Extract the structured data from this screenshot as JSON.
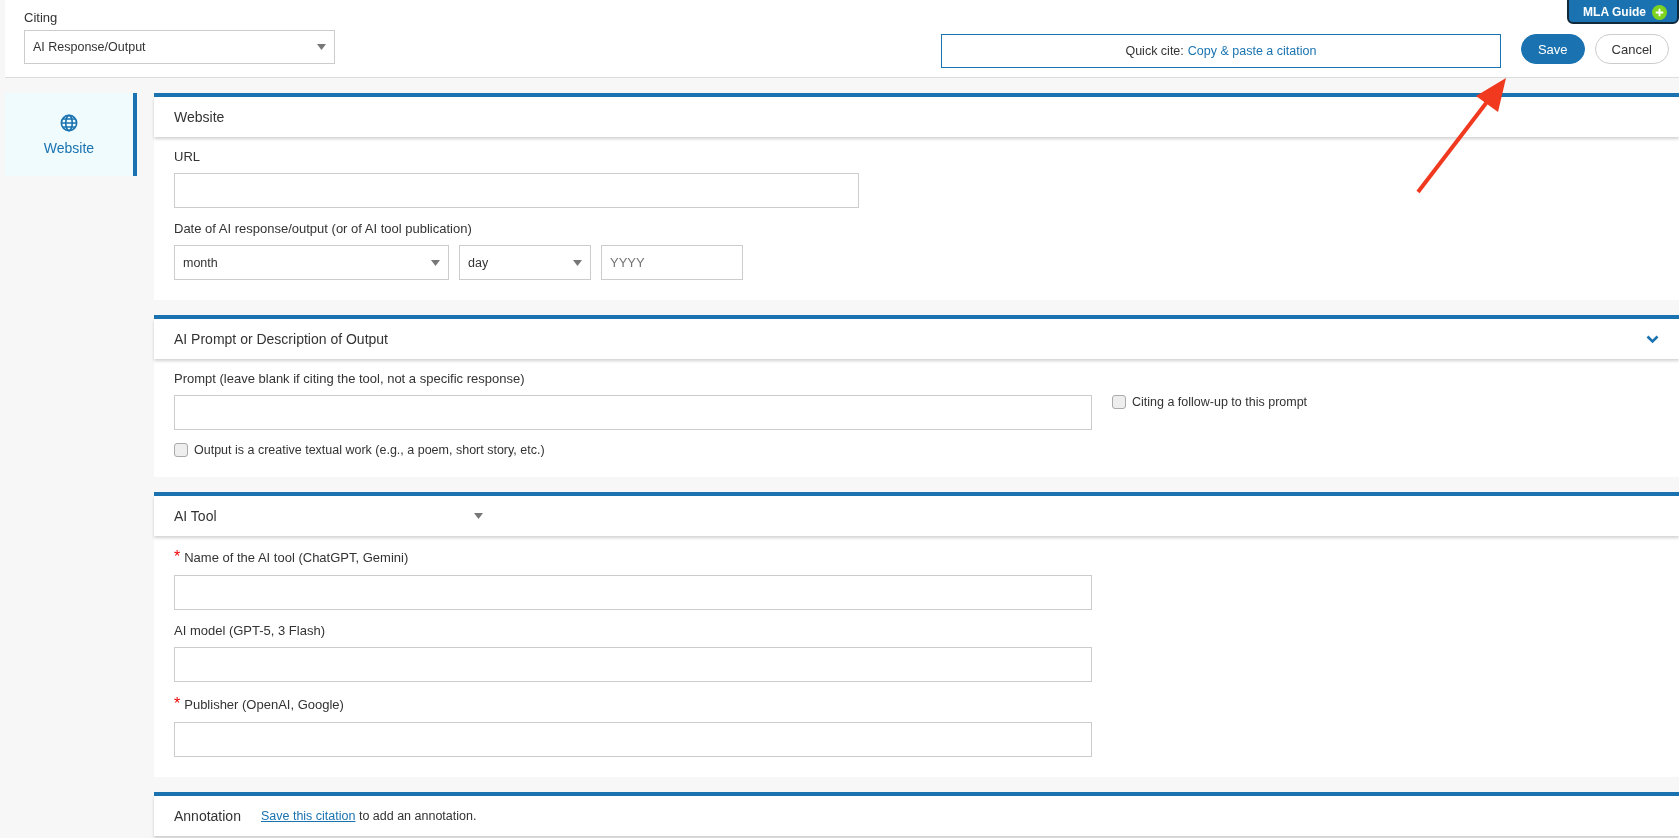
{
  "citing": {
    "label": "Citing",
    "value": "AI Response/Output"
  },
  "quick_cite": {
    "label": "Quick cite:",
    "link": "Copy & paste a citation"
  },
  "buttons": [
    {
      "label": "Save",
      "kind": "primary"
    },
    {
      "label": "Cancel",
      "kind": "secondary"
    }
  ],
  "guide_tab": {
    "label": "MLA Guide"
  },
  "sidebar": {
    "items": [
      {
        "label": "Website",
        "selected": true
      }
    ]
  },
  "sections": [
    {
      "title": "Website",
      "kind": "plain",
      "fields": [
        {
          "kind": "url",
          "label": "URL"
        },
        {
          "kind": "date",
          "label": "Date of AI response/output (or of AI tool publication)",
          "month": "month",
          "day": "day",
          "year": {
            "placeholder": "YYYY"
          }
        }
      ]
    },
    {
      "title": "AI Prompt or Description of Output",
      "kind": "collapsible",
      "fields": [
        {
          "kind": "text_with_checkbox",
          "label": "Prompt (leave blank if citing the tool, not a specific response)",
          "checkbox": {
            "label": "Citing a follow-up to this prompt",
            "checked": false
          }
        },
        {
          "kind": "checkbox",
          "label": "Output is a creative textual work (e.g., a poem, short story, etc.)",
          "checked": false
        }
      ]
    },
    {
      "title": "AI Tool",
      "kind": "dropdown",
      "fields": [
        {
          "kind": "text",
          "required_mark": "*",
          "label": "Name of the AI tool (ChatGPT, Gemini)"
        },
        {
          "kind": "text",
          "label": "AI model (GPT-5, 3 Flash)"
        },
        {
          "kind": "text",
          "required_mark": "*",
          "label": "Publisher (OpenAI, Google)"
        }
      ]
    },
    {
      "title": "Annotation",
      "kind": "note",
      "note": {
        "link": "Save this citation",
        "text": " to add an annotation."
      }
    }
  ]
}
